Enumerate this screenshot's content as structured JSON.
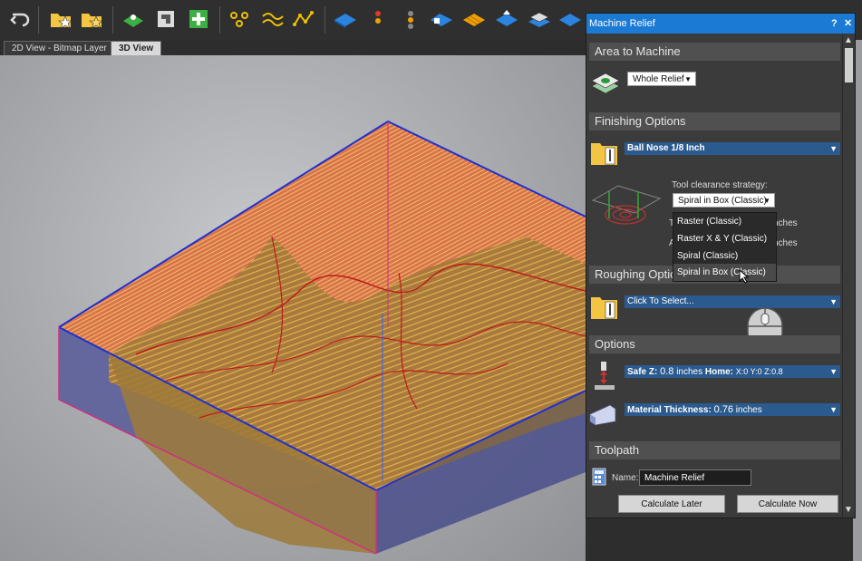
{
  "toolbar": {
    "icons": [
      "undo-icon",
      "open-folder-icon",
      "favorite-folder-icon",
      "green-layer-icon",
      "frame-icon",
      "add-icon",
      "nodes-icon",
      "smooth-nodes-icon",
      "polyline-icon",
      "blue-diamond-icon",
      "traffic-light-icon",
      "stack-icon",
      "shape-icon",
      "orange-grid-icon",
      "raise-icon",
      "layers-icon",
      "tile-icon"
    ]
  },
  "tabs": {
    "tab1": "2D View - Bitmap Layer",
    "tab2": "3D View"
  },
  "panel": {
    "title": "Machine Relief",
    "help": "?",
    "close": "✕",
    "area": {
      "header": "Area to Machine",
      "select_value": "Whole Relief"
    },
    "finishing": {
      "header": "Finishing Options",
      "tool_name": "Ball Nose 1/8 Inch",
      "strategy_label": "Tool clearance strategy:",
      "strategy_value": "Spiral in Box (Classic)",
      "partial1": "nches",
      "partial2": "nches",
      "hidden1": "T",
      "hidden2": "A",
      "options": [
        "Raster (Classic)",
        "Raster X & Y (Classic)",
        "Spiral (Classic)",
        "Spiral in Box (Classic)"
      ]
    },
    "roughing": {
      "header": "Roughing Optio",
      "select_value": "Click To Select..."
    },
    "options": {
      "header": "Options",
      "safez_label": "Safe Z:",
      "safez_value": "0.8",
      "safez_unit": "inches",
      "home_label": "Home:",
      "home_value": "X:0 Y:0 Z:0.8",
      "thick_label": "Material Thickness:",
      "thick_value": "0.76",
      "thick_unit": "inches"
    },
    "toolpath": {
      "header": "Toolpath",
      "name_label": "Name:",
      "name_value": "Machine Relief",
      "calc_later": "Calculate Later",
      "calc_now": "Calculate Now"
    }
  }
}
